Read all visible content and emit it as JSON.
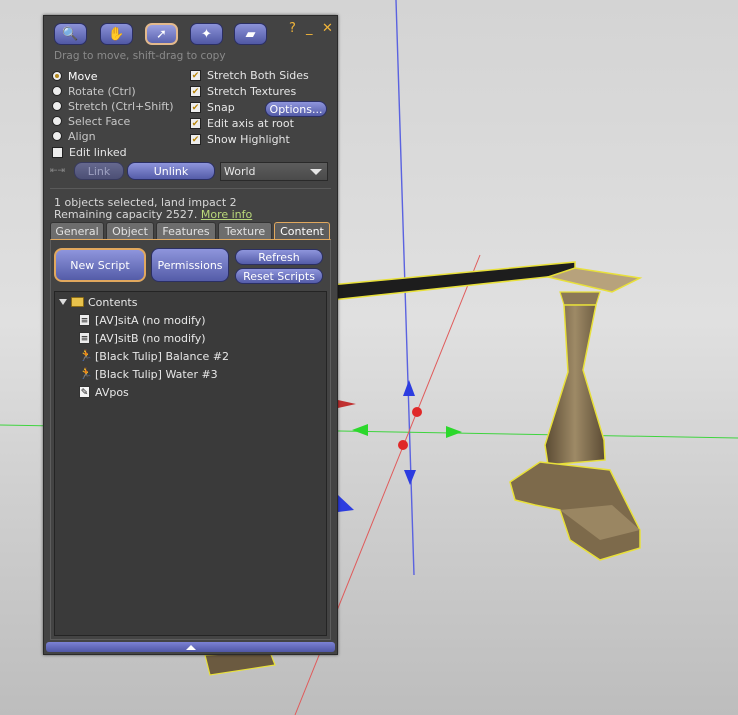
{
  "toolbar": {
    "buttons": [
      {
        "name": "focus-tool",
        "icon": "magnifier-icon"
      },
      {
        "name": "move-tool",
        "icon": "hand-icon"
      },
      {
        "name": "edit-tool",
        "icon": "pointer-icon"
      },
      {
        "name": "create-tool",
        "icon": "wand-icon"
      },
      {
        "name": "land-tool",
        "icon": "bulldozer-icon"
      }
    ],
    "help_label": "?",
    "minimize_label": "_",
    "close_label": "✕"
  },
  "hint": "Drag to move, shift-drag to copy",
  "edit_modes": [
    {
      "label": "Move",
      "selected": true
    },
    {
      "label": "Rotate (Ctrl)",
      "selected": false
    },
    {
      "label": "Stretch (Ctrl+Shift)",
      "selected": false
    },
    {
      "label": "Select Face",
      "selected": false
    },
    {
      "label": "Align",
      "selected": false
    }
  ],
  "edit_linked": {
    "label": "Edit linked",
    "checked": false
  },
  "options": [
    {
      "label": "Stretch Both Sides",
      "checked": true
    },
    {
      "label": "Stretch Textures",
      "checked": true
    },
    {
      "label": "Snap",
      "checked": true
    },
    {
      "label": "Edit axis at root",
      "checked": true
    },
    {
      "label": "Show Highlight",
      "checked": true
    }
  ],
  "options_button": "Options...",
  "link_row": {
    "link": "Link",
    "unlink": "Unlink",
    "ruler": "World"
  },
  "selection_info": {
    "line1": "1 objects selected, land impact 2",
    "line2_prefix": "Remaining capacity 2527.",
    "more_info": "More info"
  },
  "tabs": [
    {
      "label": "General",
      "active": false
    },
    {
      "label": "Object",
      "active": false
    },
    {
      "label": "Features",
      "active": false
    },
    {
      "label": "Texture",
      "active": false
    },
    {
      "label": "Content",
      "active": true
    }
  ],
  "content": {
    "new_script": "New Script",
    "permissions": "Permissions",
    "refresh": "Refresh",
    "reset_scripts": "Reset Scripts",
    "root_folder": "Contents",
    "items": [
      {
        "label": "[AV]sitA (no modify)",
        "icon": "script-icon"
      },
      {
        "label": "[AV]sitB (no modify)",
        "icon": "script-icon"
      },
      {
        "label": "[Black Tulip] Balance #2",
        "icon": "animation-icon"
      },
      {
        "label": "[Black Tulip] Water #3",
        "icon": "animation-icon"
      },
      {
        "label": "AVpos",
        "icon": "notecard-icon"
      }
    ]
  },
  "colors": {
    "panel_bg": "#434343",
    "button_blue": "#6a72c0",
    "accent_gold": "#e1a85e",
    "link_green": "#b9d87a"
  }
}
